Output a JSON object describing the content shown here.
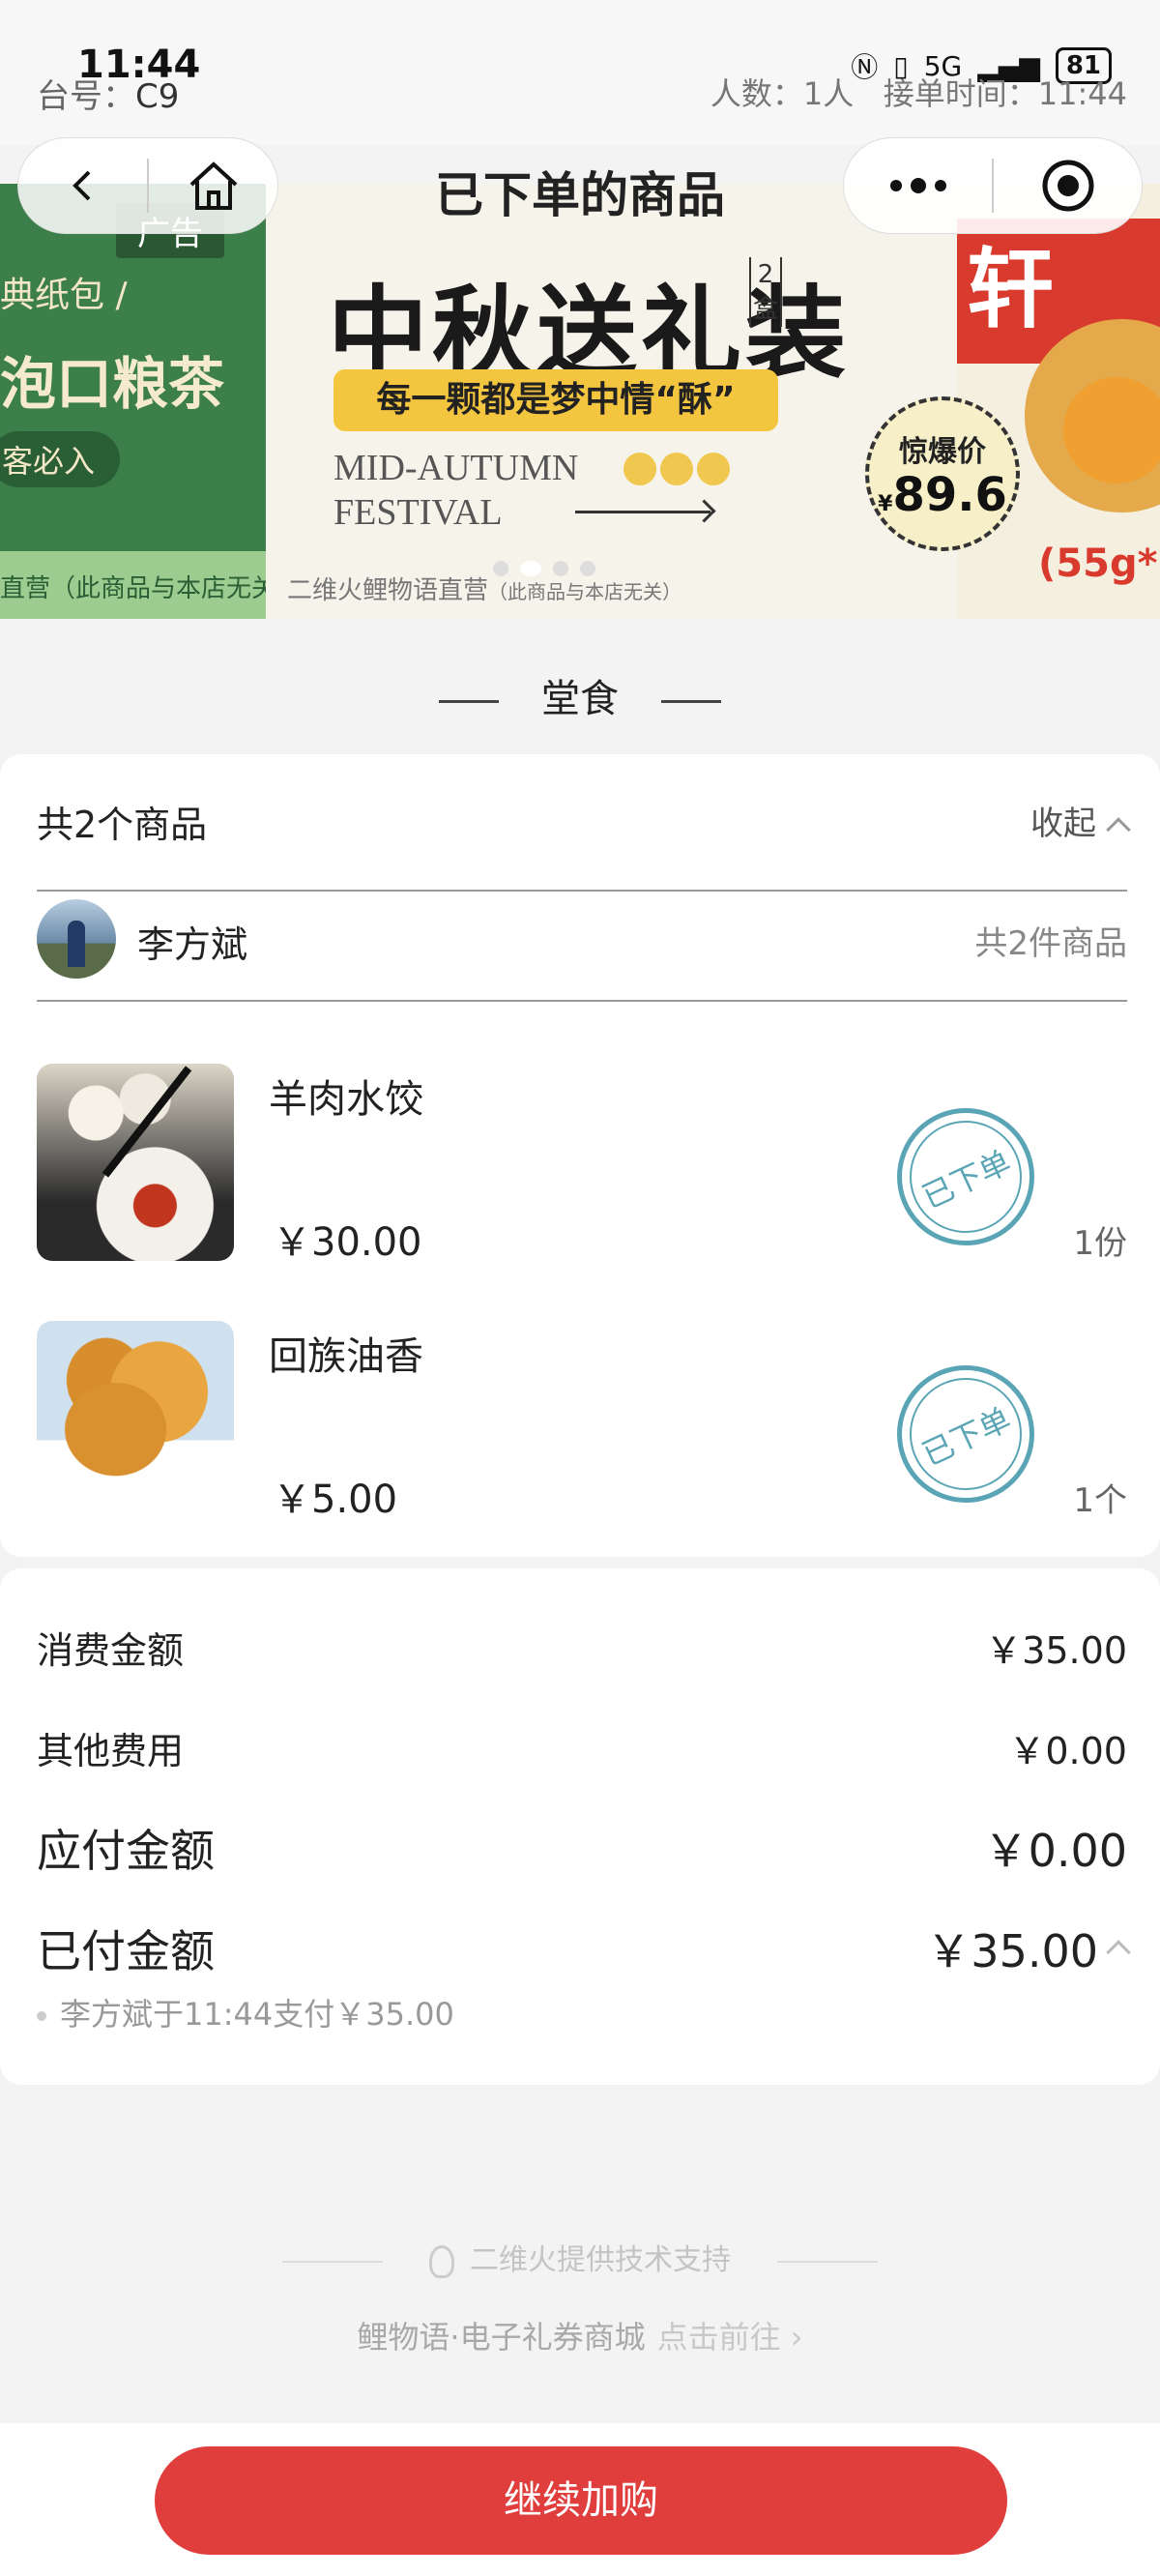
{
  "status_bar": {
    "time": "11:44",
    "signal": "5G",
    "battery": "81"
  },
  "table_info": {
    "table_label": "台号：",
    "table_number": "C9",
    "people": "人数：1人",
    "order_time": "接单时间：11:44"
  },
  "nav": {
    "title": "已下单的商品"
  },
  "banner": {
    "left_ad_tag": "广告",
    "left_line1": "典纸包 /",
    "left_line2": "泡口粮茶",
    "left_line3": "客必入",
    "left_footer": "直营（此商品与本店无关）",
    "main_title": "中秋送礼装",
    "box_count": "2盒",
    "slogan": "每一颗都是梦中情“酥”",
    "en_line1": "MID-AUTUMN",
    "en_line2": "FESTIVAL",
    "footer": "二维火鲤物语直营",
    "footer_small": "（此商品与本店无关）",
    "right_brand": "轩",
    "price_label": "惊爆价",
    "price_currency": "¥",
    "price_value": "89.6",
    "right_weight": "(55g*6"
  },
  "section_title": "堂食",
  "items_card": {
    "count_title": "共2个商品",
    "collapse_label": "收起",
    "user_name": "李方斌",
    "user_count": "共2件商品",
    "items": [
      {
        "name": "羊肉水饺",
        "price": "￥30.00",
        "qty": "1份",
        "stamp": "已下单",
        "image": "dumplings-photo"
      },
      {
        "name": "回族油香",
        "price": "￥5.00",
        "qty": "1个",
        "stamp": "已下单",
        "image": "fried-bread-photo"
      }
    ]
  },
  "summary": {
    "consumption_label": "消费金额",
    "consumption_value": "￥35.00",
    "other_label": "其他费用",
    "other_value": "￥0.00",
    "payable_label": "应付金额",
    "payable_value": "￥0.00",
    "paid_label": "已付金额",
    "paid_value": "￥35.00",
    "paid_note": "李方斌于11:44支付￥35.00"
  },
  "footer": {
    "tech_support": "二维火提供技术支持",
    "mall_name": "鲤物语·电子礼券商城",
    "mall_link": "点击前往 ›"
  },
  "cta": {
    "label": "继续加购"
  },
  "colors": {
    "accent": "#e03e3d",
    "stamp": "#5aa5b5"
  }
}
